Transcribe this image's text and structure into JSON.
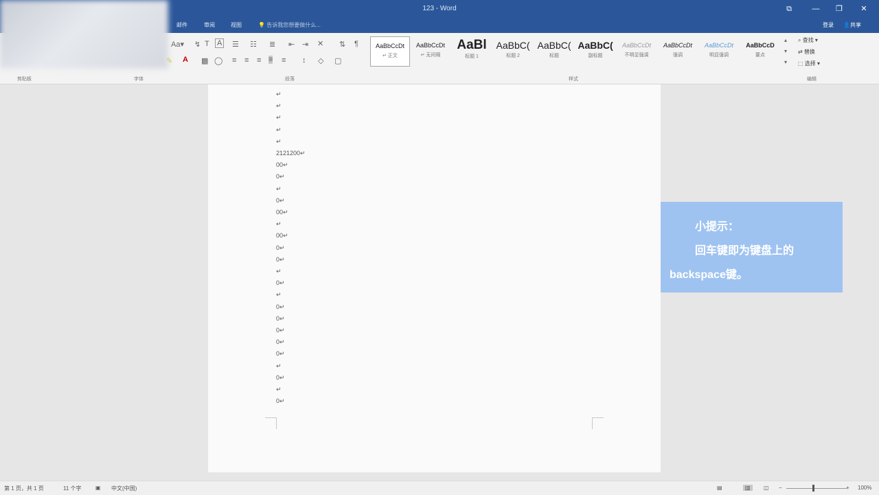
{
  "window": {
    "title": "123 - Word"
  },
  "menu": {
    "tabs": [
      "邮件",
      "审阅",
      "视图"
    ],
    "tell_me": "告诉我您想要做什么...",
    "sign_in": "登录",
    "share": "共享"
  },
  "ribbon": {
    "groups": [
      "剪贴板",
      "字体",
      "段落",
      "样式",
      "编辑"
    ],
    "styles": [
      {
        "sample": "AaBbCcDt",
        "name": "↵ 正文"
      },
      {
        "sample": "AaBbCcDt",
        "name": "↵ 无间隔"
      },
      {
        "sample": "AaBl",
        "name": "标题 1"
      },
      {
        "sample": "AaBbC(",
        "name": "标题 2"
      },
      {
        "sample": "AaBbC(",
        "name": "标题"
      },
      {
        "sample": "AaBbC(",
        "name": "副标题"
      },
      {
        "sample": "AaBbCcDt",
        "name": "不明显强调"
      },
      {
        "sample": "AaBbCcDt",
        "name": "强调"
      },
      {
        "sample": "AaBbCcDt",
        "name": "明显强调"
      },
      {
        "sample": "AaBbCcD",
        "name": "要点"
      }
    ],
    "editing": [
      "查找",
      "替换",
      "选择"
    ]
  },
  "document": {
    "lines": [
      "↵",
      "↵",
      "↵",
      "↵",
      "↵",
      "2121200↵",
      "00↵",
      "0↵",
      "↵",
      "0↵",
      "00↵",
      "↵",
      "00↵",
      "0↵",
      "0↵",
      "↵",
      "0↵",
      "↵",
      "0↵",
      "0↵",
      "0↵",
      "0↵",
      "0↵",
      "↵",
      "0↵",
      "↵",
      "0↵"
    ]
  },
  "tip": {
    "title": "小提示：",
    "line1": "回车键即为键盘上的",
    "line2": "backspace键。"
  },
  "status": {
    "page": "第 1 页，共 1 页",
    "words": "11 个字",
    "language": "中文(中国)",
    "zoom": "100%"
  },
  "colors": {
    "title_bar": "#2b579a",
    "tip_bg": "#9fc3f0"
  }
}
